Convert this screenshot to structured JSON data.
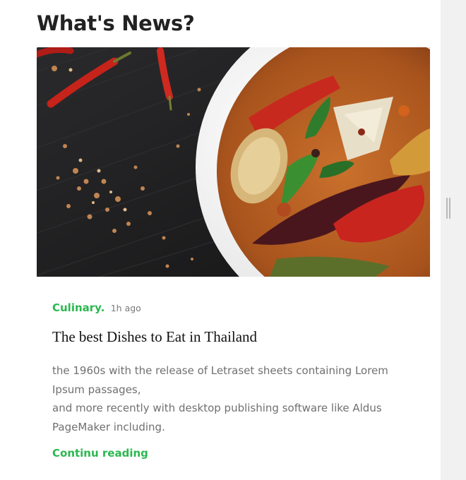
{
  "section": {
    "title": "What's News?"
  },
  "article": {
    "image_alt": "thai-curry-bowl-photo",
    "category": "Culinary.",
    "time_ago": "1h ago",
    "title": "The best Dishes to Eat in Thailand",
    "excerpt_lines": [
      "the 1960s with the release of Letraset sheets containing Lorem Ipsum passages,",
      "and more recently with desktop publishing software like Aldus PageMaker including."
    ],
    "read_more": "Continu reading"
  },
  "colors": {
    "accent": "#2bb84f",
    "title": "#222222",
    "body_text": "#707070",
    "scrollbar_track": "#f1f1f2"
  }
}
